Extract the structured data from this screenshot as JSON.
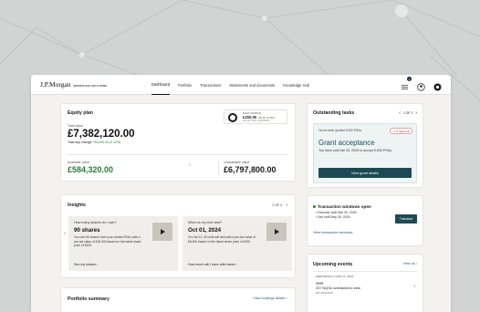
{
  "header": {
    "logo": "J.P.Morgan",
    "logo_sub": "WORKPLACE SOLUTIONS",
    "nav": [
      "Dashboard",
      "Portfolio",
      "Transactions",
      "Statements and documents",
      "Knowledge Hub"
    ],
    "notification_count": "1"
  },
  "equity": {
    "title": "Equity plan",
    "total_label": "Total value",
    "total_value": "£7,382,120.00",
    "day_change_label": "Total day change",
    "day_change_value": "+£5,000.00 (0.12%)",
    "ticker_symbol": "RACT NASDAQ",
    "ticker_price": "£200.00",
    "ticker_change": "+£5.00 (1.00%)",
    "ticker_date": "Dec 20, 2023, 4:32 PM ET",
    "available_label": "Available value",
    "available_value": "£584,320.00",
    "unavailable_label": "Unavailable value",
    "unavailable_value": "£6,797,800.00"
  },
  "insights": {
    "title": "Insights",
    "pager": "2 OF 2",
    "cards": [
      {
        "question": "How many shares do I own?",
        "headline": "90 shares",
        "body": "You own 90 shares from your vested RSUs with a pre-tax value of £18,000 based on the latest share price of £200.",
        "link": "See my shares"
      },
      {
        "question": "When is my next vest?",
        "headline": "Oct 01, 2024",
        "body": "On Oct 01, 40 units will vest with a pre-tax value of £8,000 based on the latest share price of £200.",
        "link": "How much will I have after taxes"
      }
    ]
  },
  "portfolio": {
    "title": "Portfolio summary",
    "link": "View holdings details"
  },
  "tasks": {
    "title": "Outstanding tasks",
    "pager": "1 OF 2",
    "granted_note": "You've been granted 5,000 PSUs.",
    "due_badge": "6 days left",
    "headline": "Grant acceptance",
    "body": "You have until Jan 03, 2025 to accept 5,000 PSUs.",
    "button": "View grant details"
  },
  "windows": {
    "title": "Transaction windows open",
    "lines": [
      "Exercise until Mar 20, 2024.",
      "Sell until May 30, 2024."
    ],
    "button": "Transact",
    "link": "View transaction windows"
  },
  "events": {
    "title": "Upcoming events",
    "view_all": "View all",
    "date": "WEDNESDAY FEB 07, 2024",
    "event_title": "Vest",
    "event_desc": "237 NQOs scheduled to vest.",
    "event_code": "MF-2018-010"
  },
  "colors": {
    "positive": "#2a7a3b",
    "accent_dark": "#1d4a52",
    "link": "#1e5c8a",
    "due": "#b32d22"
  }
}
